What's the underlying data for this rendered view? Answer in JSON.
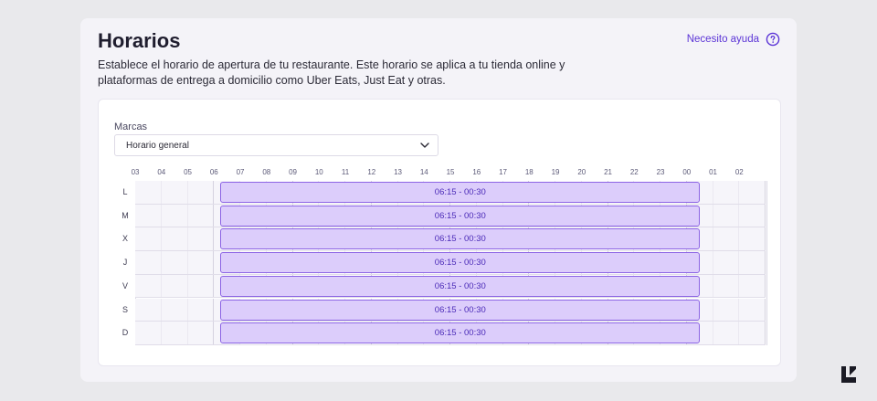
{
  "header": {
    "title": "Horarios",
    "description": "Establece el horario de apertura de tu restaurante. Este horario se aplica a tu tienda online y plataformas de entrega a domicilio como Uber Eats, Just Eat y otras.",
    "help_label": "Necesito ayuda",
    "help_icon": "question-circle-icon"
  },
  "brands": {
    "label": "Marcas",
    "selected": "Horario general",
    "chevron_icon": "chevron-down-icon"
  },
  "schedule": {
    "hours": [
      "03",
      "04",
      "05",
      "06",
      "07",
      "08",
      "09",
      "10",
      "11",
      "12",
      "13",
      "14",
      "15",
      "16",
      "17",
      "18",
      "19",
      "20",
      "21",
      "22",
      "23",
      "00",
      "01",
      "02"
    ],
    "days": [
      {
        "label": "L",
        "slot": "06:15 - 00:30"
      },
      {
        "label": "M",
        "slot": "06:15 - 00:30"
      },
      {
        "label": "X",
        "slot": "06:15 - 00:30"
      },
      {
        "label": "J",
        "slot": "06:15 - 00:30"
      },
      {
        "label": "V",
        "slot": "06:15 - 00:30"
      },
      {
        "label": "S",
        "slot": "06:15 - 00:30"
      },
      {
        "label": "D",
        "slot": "06:15 - 00:30"
      }
    ],
    "slot_start_hour": 6.25,
    "slot_end_hour": 24.5,
    "axis_start_hour": 3
  },
  "colors": {
    "accent": "#5b34d6",
    "slot_fill": "#dccdfb",
    "slot_border": "#8c64e4"
  },
  "logo_icon": "brand-logo-icon"
}
